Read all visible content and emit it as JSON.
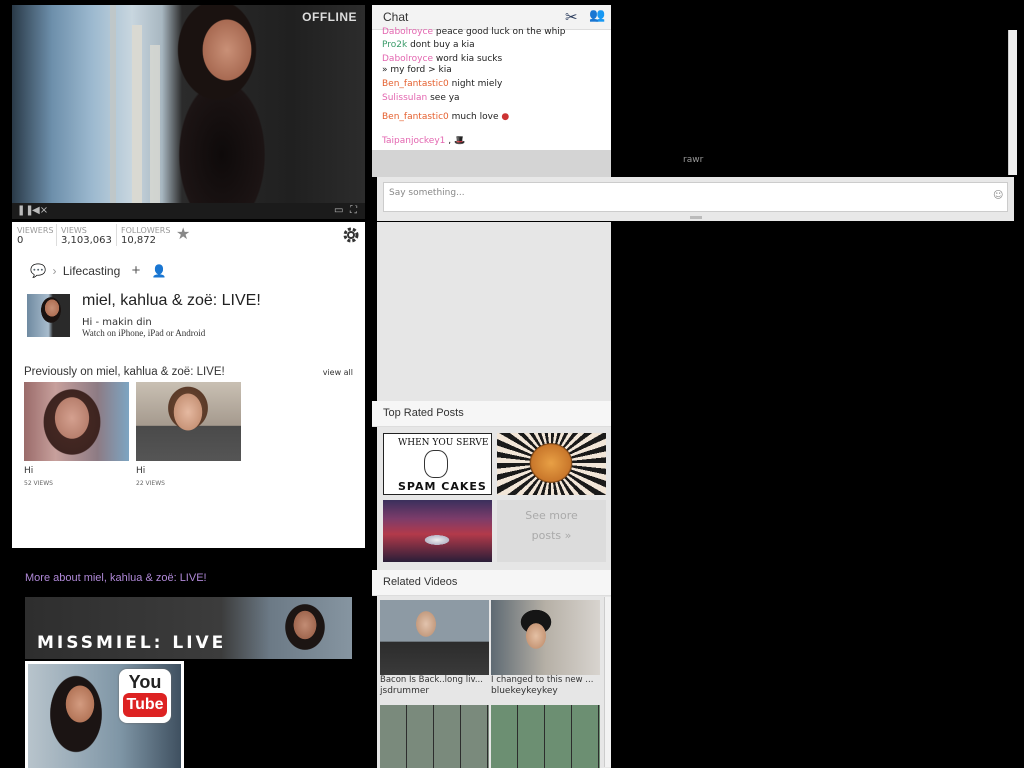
{
  "player": {
    "status": "OFFLINE",
    "controls": {
      "pause_icon": "pause-icon",
      "mute_icon": "mute-icon",
      "popout_icon": "popout-icon",
      "fullscreen_icon": "fullscreen-icon"
    }
  },
  "stats": [
    {
      "label": "VIEWERS",
      "value": "0"
    },
    {
      "label": "VIEWS",
      "value": "3,103,063"
    },
    {
      "label": "FOLLOWERS",
      "value": "10,872"
    }
  ],
  "breadcrumb": {
    "category": "Lifecasting"
  },
  "channel": {
    "title": "miel, kahlua & zoë: LIVE!",
    "status_line": "Hi - makin din",
    "mobile_line": "Watch on iPhone, iPad or Android"
  },
  "previously": {
    "heading": "Previously on miel, kahlua & zoë: LIVE!",
    "view_all": "view all",
    "videos": [
      {
        "title": "Hi",
        "views": "52 VIEWS"
      },
      {
        "title": "Hi",
        "views": "22 VIEWS"
      }
    ]
  },
  "more_about": "More about miel, kahlua & zoë: LIVE!",
  "banner": {
    "text": "MISSMIEL: LIVE"
  },
  "youtube": {
    "you": "You",
    "tube": "Tube"
  },
  "chat": {
    "title": "Chat",
    "messages": [
      {
        "user": "Dabolroyce",
        "user_color": "#e366b0",
        "text": "peace good luck on the whip"
      },
      {
        "user": "Pro2k",
        "user_color": "#3b9c6a",
        "text": "dont buy a kia"
      },
      {
        "user": "Dabolroyce",
        "user_color": "#e366b0",
        "text": "word kia sucks"
      },
      {
        "user": "",
        "user_color": "#222222",
        "text": "» my ford > kia"
      },
      {
        "user": "Ben_fantastic0",
        "user_color": "#e5602f",
        "text": "night miely"
      },
      {
        "user": "Sulissulan",
        "user_color": "#e366b0",
        "text": "see ya"
      },
      {
        "user": "Ben_fantastic0",
        "user_color": "#e5602f",
        "text": "much love"
      },
      {
        "user": "Taipanjockey1",
        "user_color": "#e366b0",
        "text": ","
      }
    ],
    "input_placeholder": "Say something...",
    "overlay_text": "rawr"
  },
  "top_rated": {
    "title": "Top Rated Posts",
    "post1_top": "WHEN YOU SERVE",
    "post1_bottom": "SPAM CAKES",
    "see_more_1": "See more",
    "see_more_2": "posts »"
  },
  "related": {
    "title": "Related Videos",
    "videos": [
      {
        "title": "Bacon Is Back..long liv...",
        "user": "jsdrummer"
      },
      {
        "title": "I changed to this new ...",
        "user": "bluekeykeykey"
      }
    ]
  },
  "colors": {
    "accent_purple": "#b089d8",
    "username_pink": "#e366b0",
    "username_orange": "#e5602f",
    "username_green": "#3b9c6a"
  }
}
